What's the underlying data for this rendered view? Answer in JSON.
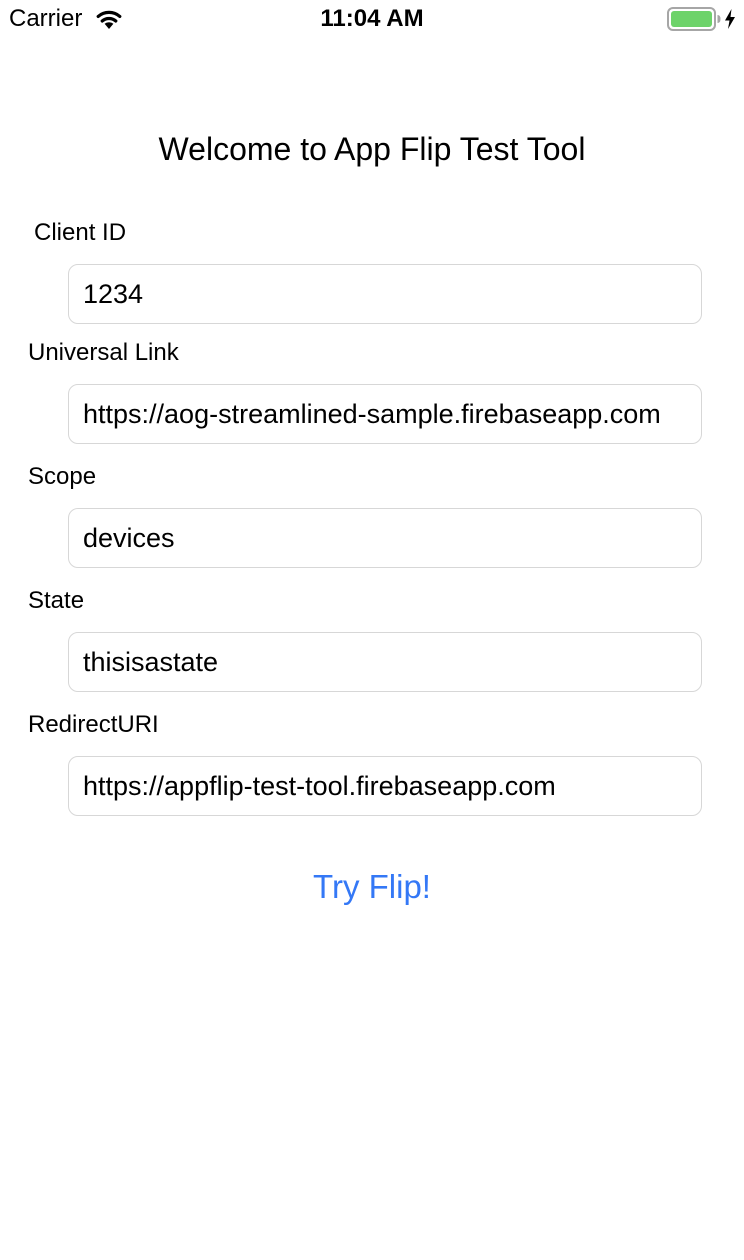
{
  "status_bar": {
    "carrier": "Carrier",
    "time": "11:04 AM",
    "battery_level": 1.0,
    "battery_charging": true,
    "battery_color": "#6dd36a",
    "wifi_icon": "wifi-icon",
    "battery_icon": "battery-icon",
    "bolt_icon": "charging-bolt-icon"
  },
  "main": {
    "title": "Welcome to App Flip Test Tool",
    "fields": [
      {
        "label": "Client ID",
        "value": "1234"
      },
      {
        "label": "Universal Link",
        "value": "https://aog-streamlined-sample.firebaseapp.com"
      },
      {
        "label": "Scope",
        "value": "devices"
      },
      {
        "label": "State",
        "value": "thisisastate"
      },
      {
        "label": "RedirectURI",
        "value": "https://appflip-test-tool.firebaseapp.com"
      }
    ],
    "button_label": "Try Flip!",
    "accent_color": "#3478f6"
  }
}
